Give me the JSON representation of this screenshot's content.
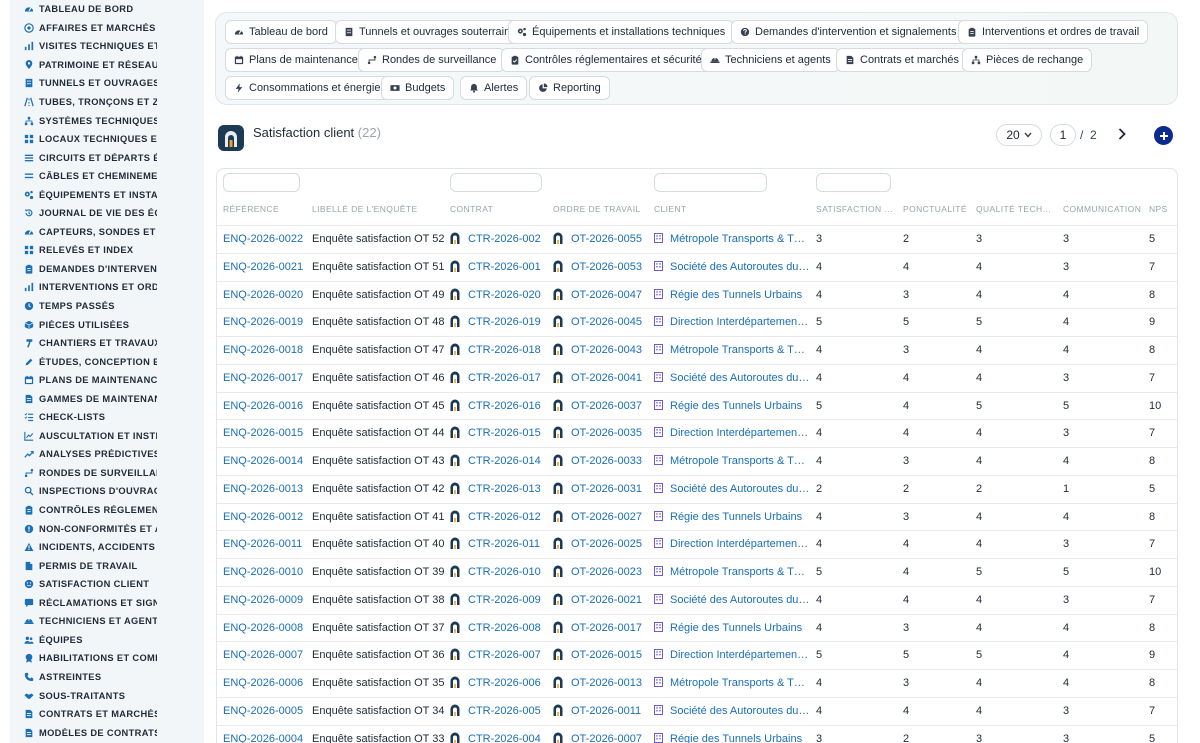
{
  "sidebar": {
    "items": [
      {
        "label": "TABLEAU DE BORD",
        "icon": "gauge-icon"
      },
      {
        "label": "AFFAIRES ET MARCHÉS",
        "icon": "target-icon"
      },
      {
        "label": "VISITES TECHNIQUES ET",
        "icon": "chart-icon"
      },
      {
        "label": "PATRIMOINE ET RÉSEAUX",
        "icon": "map-pin-icon"
      },
      {
        "label": "TUNNELS ET OUVRAGES",
        "icon": "building-icon"
      },
      {
        "label": "TUBES, TRONÇONS ET ZO",
        "icon": "road-icon"
      },
      {
        "label": "SYSTÈMES TECHNIQUES",
        "icon": "sitemap-icon"
      },
      {
        "label": "LOCAUX TECHNIQUES ET",
        "icon": "grid-icon"
      },
      {
        "label": "CIRCUITS ET DÉPARTS ÉL",
        "icon": "list-icon"
      },
      {
        "label": "CÂBLES ET CHEMINEMEN",
        "icon": "lines-icon"
      },
      {
        "label": "ÉQUIPEMENTS ET INSTAL",
        "icon": "gears-icon"
      },
      {
        "label": "JOURNAL DE VIE DES ÉQ",
        "icon": "history-icon"
      },
      {
        "label": "CAPTEURS, SONDES ET C",
        "icon": "gauge-icon"
      },
      {
        "label": "RELEVÉS ET INDEX",
        "icon": "grid-icon"
      },
      {
        "label": "DEMANDES D'INTERVENT",
        "icon": "clipboard-icon"
      },
      {
        "label": "INTERVENTIONS ET ORDI",
        "icon": "chart-icon"
      },
      {
        "label": "TEMPS PASSÉS",
        "icon": "clock-icon"
      },
      {
        "label": "PIÈCES UTILISÉES",
        "icon": "box-icon"
      },
      {
        "label": "CHANTIERS ET TRAVAUX",
        "icon": "hammer-icon"
      },
      {
        "label": "ÉTUDES, CONCEPTION ET",
        "icon": "pencil-icon"
      },
      {
        "label": "PLANS DE MAINTENANCE",
        "icon": "calendar-icon"
      },
      {
        "label": "GAMMES DE MAINTENAN",
        "icon": "document-icon"
      },
      {
        "label": "CHECK-LISTS",
        "icon": "checklist-icon"
      },
      {
        "label": "AUSCULTATION ET INSTR",
        "icon": "chart-line-icon"
      },
      {
        "label": "ANALYSES PRÉDICTIVES",
        "icon": "trend-icon"
      },
      {
        "label": "RONDES DE SURVEILLAN",
        "icon": "route-icon"
      },
      {
        "label": "INSPECTIONS D'OUVRAG",
        "icon": "search-icon"
      },
      {
        "label": "CONTRÔLES RÉGLEMENT",
        "icon": "clipboard-icon"
      },
      {
        "label": "NON-CONFORMITÉS ET A",
        "icon": "alert-circle-icon"
      },
      {
        "label": "INCIDENTS, ACCIDENTS E",
        "icon": "warning-icon"
      },
      {
        "label": "PERMIS DE TRAVAIL",
        "icon": "file-icon"
      },
      {
        "label": "SATISFACTION CLIENT",
        "icon": "smile-icon"
      },
      {
        "label": "RÉCLAMATIONS ET SIGNA",
        "icon": "comment-icon"
      },
      {
        "label": "TECHNICIENS ET AGENTS",
        "icon": "helmet-icon"
      },
      {
        "label": "ÉQUIPES",
        "icon": "users-icon"
      },
      {
        "label": "HABILITATIONS ET COMP",
        "icon": "badge-icon"
      },
      {
        "label": "ASTREINTES",
        "icon": "phone-icon"
      },
      {
        "label": "SOUS-TRAITANTS",
        "icon": "handshake-icon"
      },
      {
        "label": "CONTRATS ET MARCHÉS",
        "icon": "document-icon"
      },
      {
        "label": "MODÈLES DE CONTRATS",
        "icon": "document-icon"
      }
    ]
  },
  "quicknav": {
    "chips": [
      {
        "label": "Tableau de bord",
        "icon": "gauge-icon"
      },
      {
        "label": "Tunnels et ouvrages souterrains",
        "icon": "building-icon"
      },
      {
        "label": "Équipements et installations techniques",
        "icon": "gears-icon"
      },
      {
        "label": "Demandes d'intervention et signalements",
        "icon": "question-circle-icon"
      },
      {
        "label": "Interventions et ordres de travail",
        "icon": "clipboard-icon"
      },
      {
        "label": "Plans de maintenance",
        "icon": "calendar-icon"
      },
      {
        "label": "Rondes de surveillance",
        "icon": "route-icon"
      },
      {
        "label": "Contrôles réglementaires et sécurité",
        "icon": "clipboard-check-icon"
      },
      {
        "label": "Techniciens et agents",
        "icon": "helmet-icon"
      },
      {
        "label": "Contrats et marchés",
        "icon": "document-icon"
      },
      {
        "label": "Pièces de rechange",
        "icon": "sitemap-icon"
      },
      {
        "label": "Consommations et énergie",
        "icon": "bolt-icon"
      },
      {
        "label": "Budgets",
        "icon": "money-icon"
      },
      {
        "label": "Alertes",
        "icon": "bell-icon"
      },
      {
        "label": "Reporting",
        "icon": "pie-chart-icon"
      }
    ]
  },
  "page": {
    "title": "Satisfaction client",
    "count": "(22)"
  },
  "pagination": {
    "page_size": "20",
    "current_page": "1",
    "separator": "/",
    "total_pages": "2"
  },
  "table": {
    "columns": [
      "RÉFÉRENCE",
      "LIBELLÉ DE L'ENQUÊTE",
      "CONTRAT",
      "ORDRE DE TRAVAIL",
      "CLIENT",
      "SATISFACTION …",
      "PONCTUALITÉ",
      "QUALITÉ TECH…",
      "COMMUNICATION",
      "NPS"
    ],
    "rows": [
      {
        "ref": "ENQ-2026-0022",
        "label": "Enquête satisfaction OT 52",
        "contract": "CTR-2026-002",
        "order": "OT-2026-0055",
        "client": "Métropole Transports & T…",
        "satisfaction": "3",
        "punctuality": "2",
        "quality": "3",
        "communication": "3",
        "nps": "5"
      },
      {
        "ref": "ENQ-2026-0021",
        "label": "Enquête satisfaction OT 51",
        "contract": "CTR-2026-001",
        "order": "OT-2026-0053",
        "client": "Société des Autoroutes du…",
        "satisfaction": "4",
        "punctuality": "4",
        "quality": "4",
        "communication": "3",
        "nps": "7"
      },
      {
        "ref": "ENQ-2026-0020",
        "label": "Enquête satisfaction OT 49",
        "contract": "CTR-2026-020",
        "order": "OT-2026-0047",
        "client": "Régie des Tunnels Urbains",
        "satisfaction": "4",
        "punctuality": "3",
        "quality": "4",
        "communication": "4",
        "nps": "8"
      },
      {
        "ref": "ENQ-2026-0019",
        "label": "Enquête satisfaction OT 48",
        "contract": "CTR-2026-019",
        "order": "OT-2026-0045",
        "client": "Direction Interdépartemen…",
        "satisfaction": "5",
        "punctuality": "5",
        "quality": "5",
        "communication": "4",
        "nps": "9"
      },
      {
        "ref": "ENQ-2026-0018",
        "label": "Enquête satisfaction OT 47",
        "contract": "CTR-2026-018",
        "order": "OT-2026-0043",
        "client": "Métropole Transports & T…",
        "satisfaction": "4",
        "punctuality": "3",
        "quality": "4",
        "communication": "4",
        "nps": "8"
      },
      {
        "ref": "ENQ-2026-0017",
        "label": "Enquête satisfaction OT 46",
        "contract": "CTR-2026-017",
        "order": "OT-2026-0041",
        "client": "Société des Autoroutes du…",
        "satisfaction": "4",
        "punctuality": "4",
        "quality": "4",
        "communication": "3",
        "nps": "7"
      },
      {
        "ref": "ENQ-2026-0016",
        "label": "Enquête satisfaction OT 45",
        "contract": "CTR-2026-016",
        "order": "OT-2026-0037",
        "client": "Régie des Tunnels Urbains",
        "satisfaction": "5",
        "punctuality": "4",
        "quality": "5",
        "communication": "5",
        "nps": "10"
      },
      {
        "ref": "ENQ-2026-0015",
        "label": "Enquête satisfaction OT 44",
        "contract": "CTR-2026-015",
        "order": "OT-2026-0035",
        "client": "Direction Interdépartemen…",
        "satisfaction": "4",
        "punctuality": "4",
        "quality": "4",
        "communication": "3",
        "nps": "7"
      },
      {
        "ref": "ENQ-2026-0014",
        "label": "Enquête satisfaction OT 43",
        "contract": "CTR-2026-014",
        "order": "OT-2026-0033",
        "client": "Métropole Transports & T…",
        "satisfaction": "4",
        "punctuality": "3",
        "quality": "4",
        "communication": "4",
        "nps": "8"
      },
      {
        "ref": "ENQ-2026-0013",
        "label": "Enquête satisfaction OT 42",
        "contract": "CTR-2026-013",
        "order": "OT-2026-0031",
        "client": "Société des Autoroutes du…",
        "satisfaction": "2",
        "punctuality": "2",
        "quality": "2",
        "communication": "1",
        "nps": "5"
      },
      {
        "ref": "ENQ-2026-0012",
        "label": "Enquête satisfaction OT 41",
        "contract": "CTR-2026-012",
        "order": "OT-2026-0027",
        "client": "Régie des Tunnels Urbains",
        "satisfaction": "4",
        "punctuality": "3",
        "quality": "4",
        "communication": "4",
        "nps": "8"
      },
      {
        "ref": "ENQ-2026-0011",
        "label": "Enquête satisfaction OT 40",
        "contract": "CTR-2026-011",
        "order": "OT-2026-0025",
        "client": "Direction Interdépartemen…",
        "satisfaction": "4",
        "punctuality": "4",
        "quality": "4",
        "communication": "3",
        "nps": "7"
      },
      {
        "ref": "ENQ-2026-0010",
        "label": "Enquête satisfaction OT 39",
        "contract": "CTR-2026-010",
        "order": "OT-2026-0023",
        "client": "Métropole Transports & T…",
        "satisfaction": "5",
        "punctuality": "4",
        "quality": "5",
        "communication": "5",
        "nps": "10"
      },
      {
        "ref": "ENQ-2026-0009",
        "label": "Enquête satisfaction OT 38",
        "contract": "CTR-2026-009",
        "order": "OT-2026-0021",
        "client": "Société des Autoroutes du…",
        "satisfaction": "4",
        "punctuality": "4",
        "quality": "4",
        "communication": "3",
        "nps": "7"
      },
      {
        "ref": "ENQ-2026-0008",
        "label": "Enquête satisfaction OT 37",
        "contract": "CTR-2026-008",
        "order": "OT-2026-0017",
        "client": "Régie des Tunnels Urbains",
        "satisfaction": "4",
        "punctuality": "3",
        "quality": "4",
        "communication": "4",
        "nps": "8"
      },
      {
        "ref": "ENQ-2026-0007",
        "label": "Enquête satisfaction OT 36",
        "contract": "CTR-2026-007",
        "order": "OT-2026-0015",
        "client": "Direction Interdépartemen…",
        "satisfaction": "5",
        "punctuality": "5",
        "quality": "5",
        "communication": "4",
        "nps": "9"
      },
      {
        "ref": "ENQ-2026-0006",
        "label": "Enquête satisfaction OT 35",
        "contract": "CTR-2026-006",
        "order": "OT-2026-0013",
        "client": "Métropole Transports & T…",
        "satisfaction": "4",
        "punctuality": "3",
        "quality": "4",
        "communication": "4",
        "nps": "8"
      },
      {
        "ref": "ENQ-2026-0005",
        "label": "Enquête satisfaction OT 34",
        "contract": "CTR-2026-005",
        "order": "OT-2026-0011",
        "client": "Société des Autoroutes du…",
        "satisfaction": "4",
        "punctuality": "4",
        "quality": "4",
        "communication": "3",
        "nps": "7"
      },
      {
        "ref": "ENQ-2026-0004",
        "label": "Enquête satisfaction OT 33",
        "contract": "CTR-2026-004",
        "order": "OT-2026-0007",
        "client": "Régie des Tunnels Urbains",
        "satisfaction": "3",
        "punctuality": "2",
        "quality": "3",
        "communication": "3",
        "nps": "5"
      }
    ]
  },
  "colors": {
    "link": "#1a6fb5",
    "sidebar_bg": "#f3f6f9",
    "icon_accent": "#1a6fb5",
    "add_button": "#0b2a8f",
    "logo_bg": "#1d3a54",
    "building_icon": "#6b5bd6"
  }
}
